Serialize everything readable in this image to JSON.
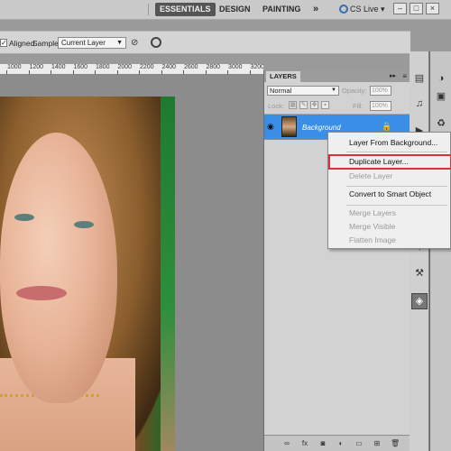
{
  "appbar": {
    "workspaces": [
      "ESSENTIALS",
      "DESIGN",
      "PAINTING"
    ],
    "more": "»",
    "cslive": "CS Live",
    "cslive_arrow": "▾",
    "win_minimize": "–",
    "win_maximize": "□",
    "win_close": "×"
  },
  "options": {
    "aligned_label": "Aligned",
    "sample_label": "Sample:",
    "sample_value": "Current Layer"
  },
  "ruler": {
    "labels": [
      "1000",
      "1200",
      "1400",
      "1600",
      "1800",
      "2000",
      "2200",
      "2400",
      "2600",
      "2800",
      "3000",
      "3200"
    ]
  },
  "layers_panel": {
    "tab": "LAYERS",
    "blend_mode": "Normal",
    "opacity_label": "Opacity:",
    "opacity_value": "100%",
    "lock_label": "Lock:",
    "fill_label": "Fill:",
    "fill_value": "100%",
    "layer_name": "Background"
  },
  "context_menu": {
    "items": [
      {
        "label": "Layer From Background...",
        "enabled": true
      },
      {
        "label": "Duplicate Layer...",
        "enabled": true,
        "highlighted": true
      },
      {
        "label": "Delete Layer",
        "enabled": false
      },
      {
        "label": "Convert to Smart Object",
        "enabled": true
      },
      {
        "label": "Merge Layers",
        "enabled": false
      },
      {
        "label": "Merge Visible",
        "enabled": false
      },
      {
        "label": "Flatten Image",
        "enabled": false
      }
    ]
  },
  "colors": {
    "selected_layer": "#3b8ee6",
    "highlight_box": "#d9303d",
    "active_workspace": "#555555"
  }
}
